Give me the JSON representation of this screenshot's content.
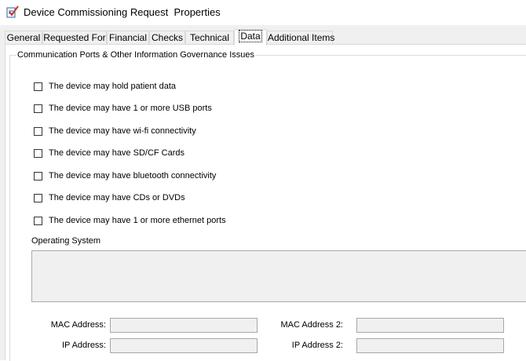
{
  "window": {
    "title": "Device Commissioning Request  Properties",
    "icon": "edit-form-icon"
  },
  "tabs": [
    {
      "label": "General"
    },
    {
      "label": "Requested For"
    },
    {
      "label": "Financial"
    },
    {
      "label": "Checks"
    },
    {
      "label": "Technical"
    },
    {
      "label": "Data",
      "active": true
    },
    {
      "label": "Additional Items"
    }
  ],
  "group": {
    "title": "Communication Ports & Other Information Governance Issues",
    "checks": [
      {
        "label": "The device may hold patient data",
        "checked": false
      },
      {
        "label": "The device may have 1 or more USB ports",
        "checked": false
      },
      {
        "label": "The device may have wi-fi connectivity",
        "checked": false
      },
      {
        "label": "The device may have SD/CF Cards",
        "checked": false
      },
      {
        "label": "The device may have bluetooth connectivity",
        "checked": false
      },
      {
        "label": "The device may have CDs or DVDs",
        "checked": false
      },
      {
        "label": "The device may have 1 or more ethernet ports",
        "checked": false
      }
    ],
    "os_label": "Operating System",
    "os_value": "",
    "fields": {
      "mac_label": "MAC Address:",
      "mac_value": "",
      "mac2_label": "MAC Address 2:",
      "mac2_value": "",
      "ip_label": "IP Address:",
      "ip_value": "",
      "ip2_label": "IP Address 2:",
      "ip2_value": ""
    }
  },
  "colors": {
    "panel": "#f0f0f0",
    "tab_active": "#ffffff",
    "icon_check": "#c0392b",
    "icon_doc": "#2f5fa7"
  }
}
